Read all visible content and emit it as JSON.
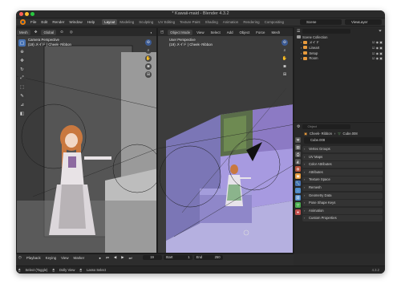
{
  "window": {
    "title": "* Kawaii-maid - Blender 4.3.2"
  },
  "menubar": {
    "items": [
      "File",
      "Edit",
      "Render",
      "Window",
      "Help"
    ],
    "workspaces": [
      "Layout",
      "Modeling",
      "Sculpting",
      "UV Editing",
      "Texture Paint",
      "Shading",
      "Animation",
      "Rendering",
      "Compositing"
    ],
    "active_workspace": "Layout",
    "scene": "Scene",
    "view_layer": "ViewLayer"
  },
  "left_viewport": {
    "mode": "Mesh",
    "orientation": "Global",
    "overlay_title": "Camera Perspective",
    "overlay_sub": "(19) メイド | Cheek- Ribbon"
  },
  "right_viewport": {
    "mode": "Object Mode",
    "menu": [
      "View",
      "Select",
      "Add",
      "Object",
      "Force",
      "Mesh"
    ],
    "overlay_title": "User Perspective",
    "overlay_sub": "(19) メイド | Cheek- Ribbon"
  },
  "outliner": {
    "search_placeholder": "",
    "collection_label": "Scene Collection",
    "items": [
      {
        "label": "メイド",
        "color": "#e79a3c"
      },
      {
        "label": "Lineart",
        "color": "#e79a3c"
      },
      {
        "label": "Setup",
        "color": "#e79a3c"
      },
      {
        "label": "Room",
        "color": "#e79a3c"
      }
    ]
  },
  "properties": {
    "search_placeholder": "Object",
    "breadcrumb_object": "Cheek- Ribbon",
    "breadcrumb_mesh": "Cube.008",
    "data_name": "Cube.008",
    "sections": [
      "Vertex Groups",
      "UV Maps",
      "Color Attributes",
      "Attributes",
      "Texture Space",
      "Remesh",
      "Geometry Data",
      "Pose Shape Keys",
      "Animation",
      "Custom Properties"
    ]
  },
  "timeline": {
    "items": [
      "Playback",
      "Keying",
      "View",
      "Marker"
    ],
    "current_frame": "19",
    "start_label": "Start",
    "start": "1",
    "end_label": "End",
    "end": "250"
  },
  "statusbar": {
    "items": [
      "Select (Toggle)",
      "Dolly View",
      "Lasso Select"
    ],
    "version": "4.3.2"
  },
  "colors": {
    "accent": "#4772b3",
    "blender_orange": "#e87d0d"
  }
}
